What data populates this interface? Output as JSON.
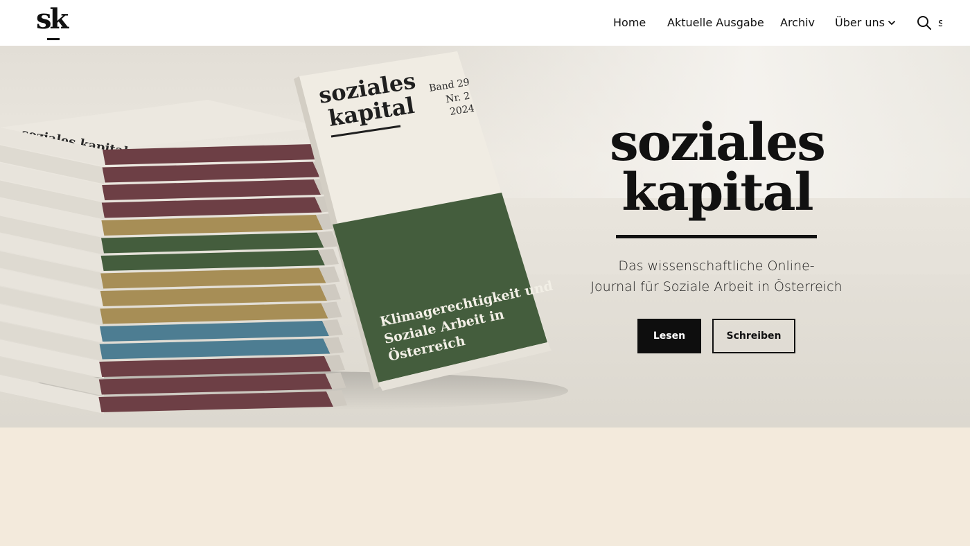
{
  "header": {
    "logo_text": "sk",
    "nav": [
      {
        "label": "Home"
      },
      {
        "label": "Aktuelle Ausgabe"
      },
      {
        "label": "Archiv"
      },
      {
        "label": "Über uns"
      }
    ],
    "search_icon": "search-icon",
    "more_glyph": "s"
  },
  "hero": {
    "title_line1": "soziales",
    "title_line2": "kapital",
    "subtitle_line1": "Das wissenschaftliche Online-",
    "subtitle_line2": "Journal für Soziale Arbeit in Österreich",
    "primary_button": "Lesen",
    "secondary_button": "Schreiben",
    "book": {
      "brand_line1": "soziales",
      "brand_line2": "kapital",
      "volume": "Band 29",
      "issue": "Nr. 2",
      "year": "2024",
      "topic_line1": "Klimagerechtigkeit und",
      "topic_line2": "Soziale Arbeit in",
      "topic_line3": "Österreich"
    },
    "stack_label": "soziales kapital"
  },
  "colors": {
    "page_background": "#f3eadc",
    "header_background": "#ffffff",
    "button_primary": "#0e0e0e",
    "book_cover_green": "#445d3d",
    "spine_maroon": "#6d3f45",
    "spine_ochre": "#a78e56",
    "spine_blue": "#4d7d92"
  }
}
